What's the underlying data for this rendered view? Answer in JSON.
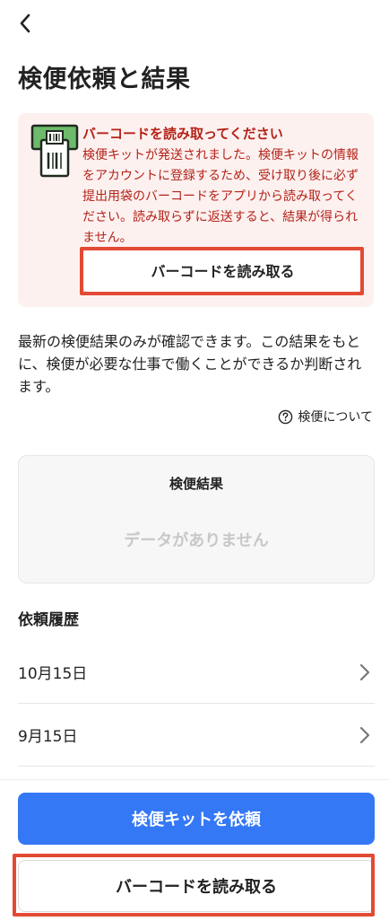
{
  "header": {
    "back_icon": "chevron-left-icon",
    "title": "検便依頼と結果"
  },
  "alert": {
    "icon": "barcode-scanner-icon",
    "title": "バーコードを読み取ってください",
    "body": "検便キットが発送されました。検便キットの情報をアカウントに登録するため、受け取り後に必ず提出用袋のバーコードをアプリから読み取ってください。読み取らずに返送すると、結果が得られません。",
    "button_label": "バーコードを読み取る",
    "colors": {
      "background": "#fdf1f0",
      "text": "#b42318",
      "highlight": "#e34a33"
    }
  },
  "description": "最新の検便結果のみが確認できます。この結果をもとに、検便が必要な仕事で働くことができるか判断されます。",
  "about_link": {
    "icon": "help-circle-icon",
    "label": "検便について"
  },
  "results": {
    "title": "検便結果",
    "empty_text": "データがありません"
  },
  "history": {
    "title": "依頼履歴",
    "items": [
      {
        "label": "10月15日"
      },
      {
        "label": "9月15日"
      }
    ]
  },
  "footer": {
    "primary_label": "検便キットを依頼",
    "secondary_label": "バーコードを読み取る",
    "colors": {
      "primary": "#3478f6"
    }
  }
}
